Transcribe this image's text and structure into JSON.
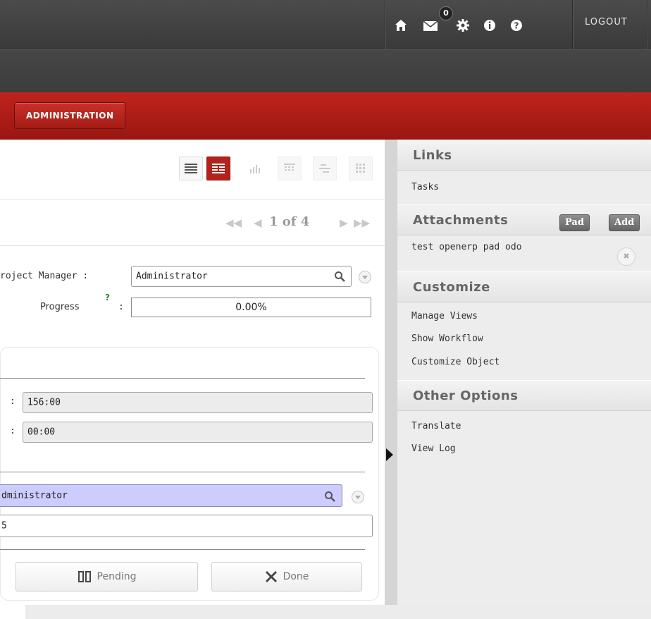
{
  "topbar": {
    "icons": [
      "home-icon",
      "mail-icon",
      "gear-icon",
      "info-icon",
      "help-icon"
    ],
    "mail_count": "0",
    "logout_label": "LOGOUT"
  },
  "menu": {
    "active_label": "ADMINISTRATION"
  },
  "toolbar": {
    "views": [
      "list-view-icon",
      "form-view-icon",
      "graph-view-icon",
      "calendar-view-icon",
      "gantt-view-icon",
      "grid-view-icon"
    ],
    "active_view": "form-view-icon"
  },
  "pager": {
    "text": "1 of 4"
  },
  "form": {
    "project_manager_label": "roject Manager :",
    "project_manager_value": "Administrator",
    "progress_label": "Progress",
    "progress_help": "?",
    "progress_colon": ":",
    "progress_value": "0.00%",
    "field1_colon": ":",
    "field1_value": "156:00",
    "field2_colon": ":",
    "field2_value": "00:00",
    "user_value": "dministrator",
    "sequence_value": "5",
    "pending_label": "Pending",
    "done_label": "Done"
  },
  "sidebar": {
    "links_title": "Links",
    "links": [
      "Tasks"
    ],
    "attachments_title": "Attachments",
    "pad_label": "Pad",
    "add_label": "Add",
    "attachments": [
      "test openerp pad odo"
    ],
    "customize_title": "Customize",
    "customize_items": [
      "Manage Views",
      "Show Workflow",
      "Customize Object"
    ],
    "other_title": "Other Options",
    "other_items": [
      "Translate",
      "View Log"
    ]
  },
  "colors": {
    "accent_red": "#b3231c",
    "topbar": "#404040",
    "blue_field": "#ccccff"
  }
}
